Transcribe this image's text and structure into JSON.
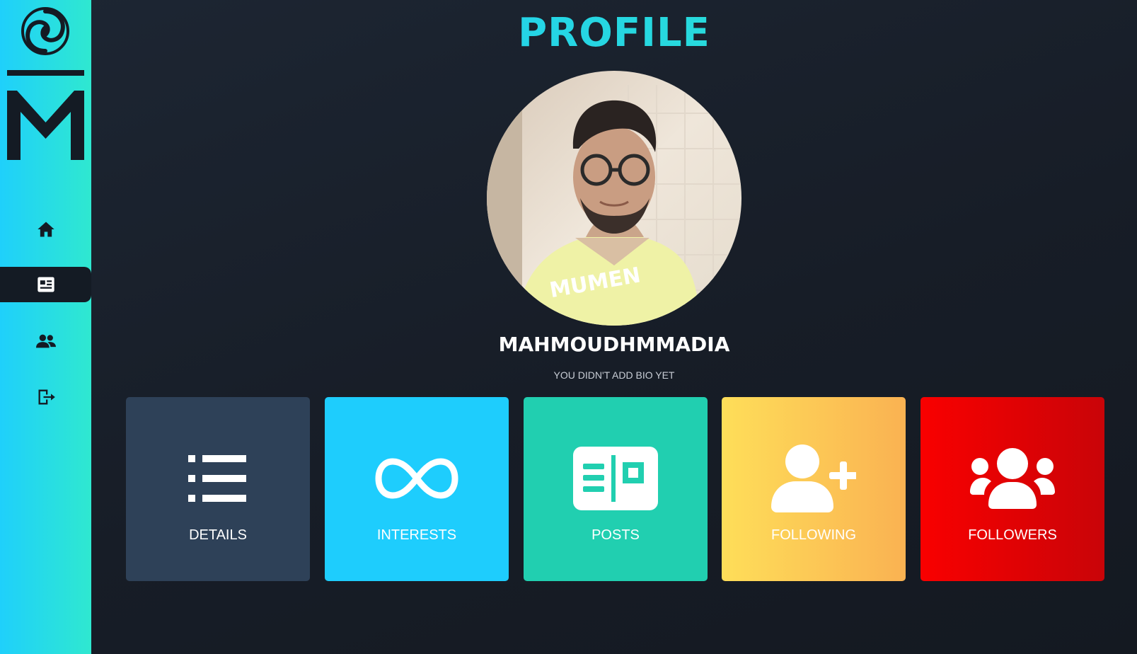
{
  "page": {
    "title": "PROFILE"
  },
  "sidebar": {
    "logo_icon": "swirl-logo-icon",
    "logo_letter_icon": "m-logo-icon",
    "items": [
      {
        "name": "home",
        "icon": "home-icon",
        "active": false
      },
      {
        "name": "profile",
        "icon": "profile-card-icon",
        "active": true
      },
      {
        "name": "friends",
        "icon": "users-icon",
        "active": false
      },
      {
        "name": "logout",
        "icon": "logout-icon",
        "active": false
      }
    ]
  },
  "profile": {
    "username": "MAHMOUDHMMADIA",
    "bio": "YOU DIDN'T ADD BIO YET"
  },
  "cards": [
    {
      "label": "DETAILS",
      "icon": "list-icon",
      "color": "#2e4158"
    },
    {
      "label": "INTERESTS",
      "icon": "infinity-icon",
      "color": "#1ecdfd"
    },
    {
      "label": "POSTS",
      "icon": "newspaper-icon",
      "color": "#21cfb0"
    },
    {
      "label": "FOLLOWING",
      "icon": "user-plus-icon",
      "color": "#fede59"
    },
    {
      "label": "FOLLOWERS",
      "icon": "users-icon",
      "color": "#f90000"
    }
  ],
  "colors": {
    "accent": "#1ecdfd",
    "accent_alt": "#2ee6c4",
    "background": "#1a212c",
    "sidebar_active": "#141b24"
  }
}
